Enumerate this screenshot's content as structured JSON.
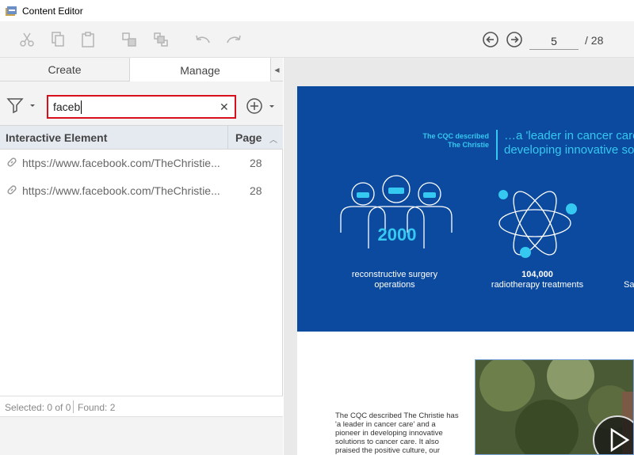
{
  "window": {
    "title": "Content Editor"
  },
  "toolbar": {
    "icons": [
      "cut-icon",
      "copy-icon",
      "paste-icon",
      "group-icon",
      "ungroup-icon",
      "undo-icon",
      "redo-icon"
    ],
    "nav": {
      "prev_icon": "arrow-left-circle-icon",
      "next_icon": "arrow-right-circle-icon"
    },
    "page_current": "5",
    "page_total": "/ 28"
  },
  "panel": {
    "tabs": [
      {
        "label": "Create",
        "active": false
      },
      {
        "label": "Manage",
        "active": true
      }
    ],
    "search": {
      "value": "faceb",
      "clear_label": "✕"
    },
    "columns": {
      "element": "Interactive Element",
      "page": "Page"
    },
    "rows": [
      {
        "url": "https://www.facebook.com/TheChristie...",
        "page": "28"
      },
      {
        "url": "https://www.facebook.com/TheChristie...",
        "page": "28"
      }
    ],
    "status": {
      "selected": "Selected: 0 of 0",
      "found": "Found: 2"
    }
  },
  "document": {
    "cqc_small": "The CQC described The Christie",
    "quote_line1": "…a 'leader in cancer care'",
    "quote_line2": "developing innovative solu",
    "stat1": {
      "number": "2000",
      "label": "reconstructive surgery operations"
    },
    "stat2": {
      "number": "104,000",
      "label": "radiotherapy treatments"
    },
    "stat3_partial": "Sa",
    "paragraph": "The CQC described The Christie has 'a leader in cancer care' and a pioneer in developing innovative solutions to cancer care. It also praised the positive culture, our compassionate",
    "colors": {
      "banner": "#0b4a9e",
      "accent": "#35c8f0",
      "search_highlight": "#d8101b"
    }
  }
}
